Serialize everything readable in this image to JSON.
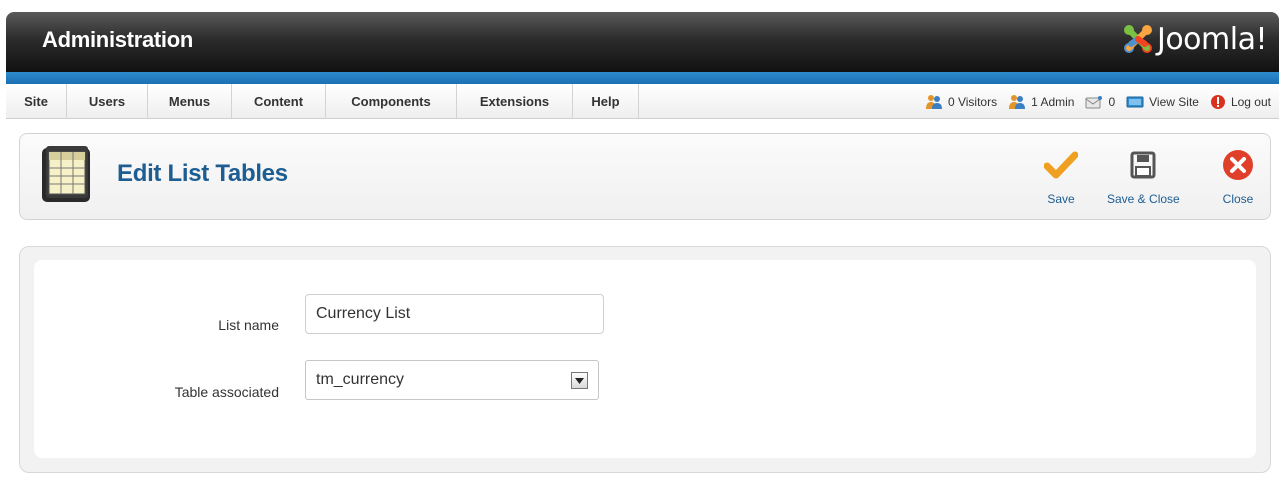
{
  "header": {
    "title": "Administration",
    "logo_text": "Joomla!"
  },
  "menu": [
    {
      "label": "Site"
    },
    {
      "label": "Users"
    },
    {
      "label": "Menus"
    },
    {
      "label": "Content"
    },
    {
      "label": "Components"
    },
    {
      "label": "Extensions"
    },
    {
      "label": "Help"
    }
  ],
  "status": {
    "visitors": "0 Visitors",
    "admins": "1 Admin",
    "messages": "0",
    "view_site": "View Site",
    "logout": "Log out"
  },
  "toolbar": {
    "title": "Edit List Tables",
    "save_label": "Save",
    "save_close_label": "Save & Close",
    "close_label": "Close"
  },
  "form": {
    "list_name_label": "List name",
    "list_name_value": "Currency List",
    "table_label": "Table associated",
    "table_value": "tm_currency"
  },
  "colors": {
    "accent_blue": "#1d5d92",
    "header_dark": "#2c2c2c",
    "strip_blue": "#1a6fb1",
    "save_orange": "#f0a020",
    "close_red": "#e0402a"
  }
}
